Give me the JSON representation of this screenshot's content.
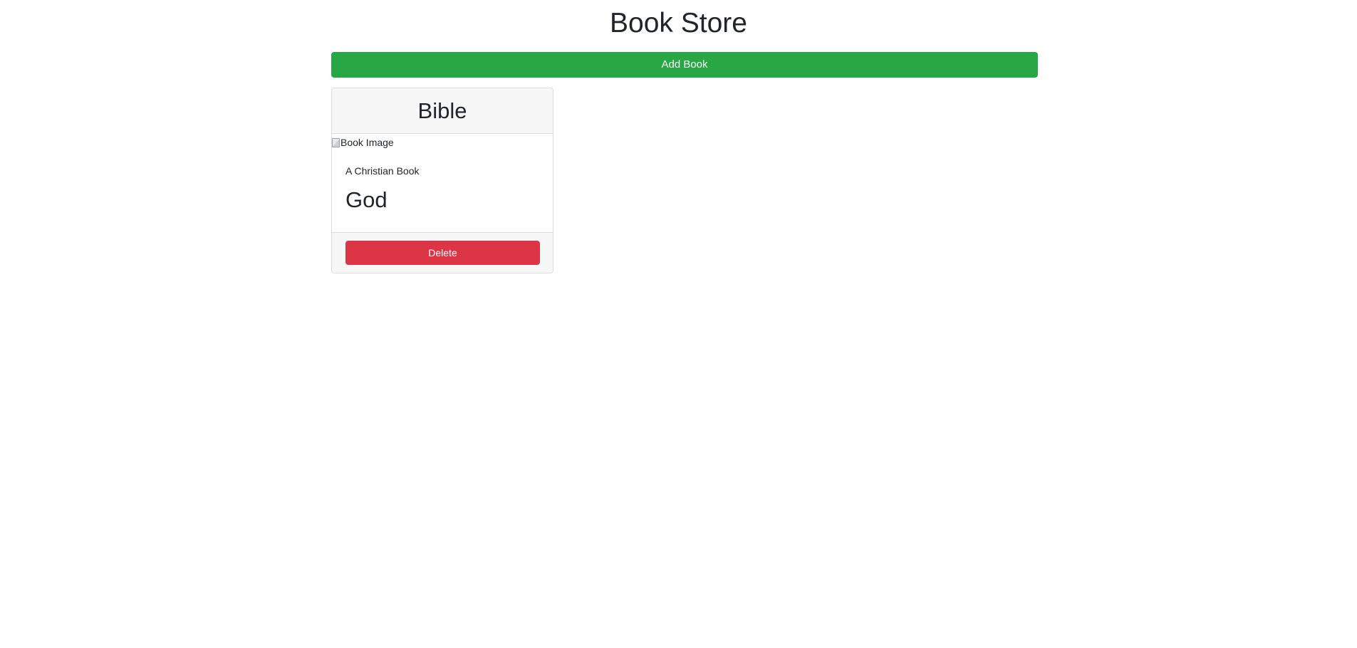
{
  "app": {
    "title": "Book Store"
  },
  "actions": {
    "add_book_label": "Add Book"
  },
  "colors": {
    "add_button": "#28a745",
    "delete_button": "#dc3545",
    "card_header_bg": "#f7f7f7"
  },
  "books": [
    {
      "title": "Bible",
      "image_alt": "Book Image",
      "description": "A Christian Book",
      "author": "God",
      "delete_label": "Delete"
    }
  ]
}
